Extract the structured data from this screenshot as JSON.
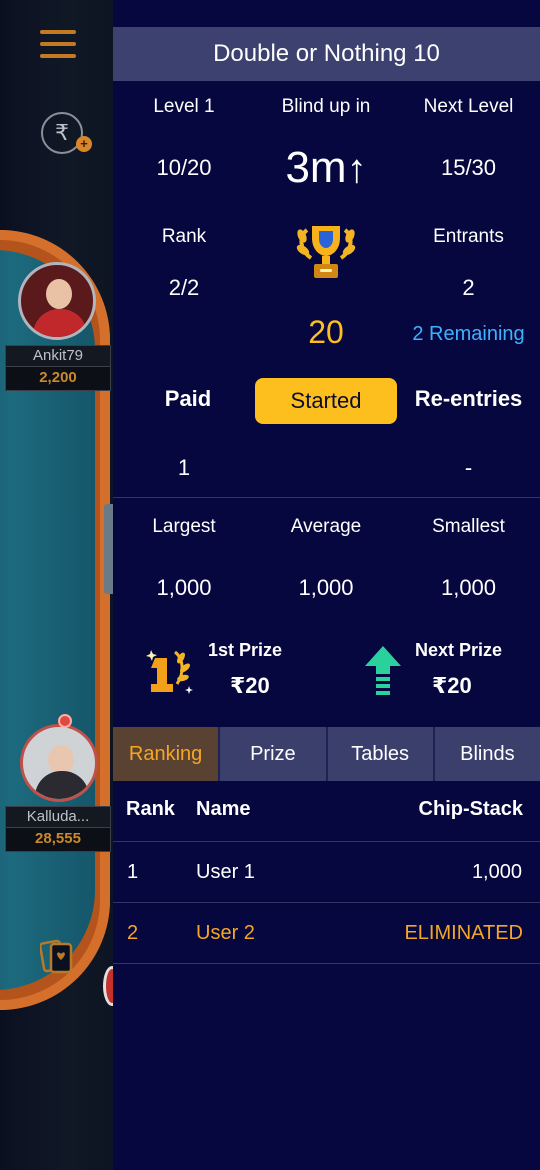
{
  "background": {
    "players": [
      {
        "name": "Ankit79",
        "chips": "2,200"
      },
      {
        "name": "Kalluda...",
        "chips": "28,555"
      }
    ],
    "rupee_symbol": "₹",
    "rupee_plus": "+"
  },
  "tournament": {
    "title": "Double or Nothing 10",
    "level_label": "Level 1",
    "level_value": "10/20",
    "blind_label": "Blind up in",
    "blind_value": "3m",
    "blind_arrow": "↑",
    "next_level_label": "Next Level",
    "next_level_value": "15/30",
    "rank_label": "Rank",
    "rank_value": "2/2",
    "entrants_label": "Entrants",
    "entrants_value": "2",
    "prize_pool": "20",
    "remaining": "2 Remaining",
    "paid_label": "Paid",
    "paid_value": "1",
    "status_button": "Started",
    "reentries_label": "Re-entries",
    "reentries_value": "-",
    "stacks": {
      "largest_label": "Largest",
      "largest_value": "1,000",
      "average_label": "Average",
      "average_value": "1,000",
      "smallest_label": "Smallest",
      "smallest_value": "1,000"
    },
    "first_prize_label": "1st Prize",
    "first_prize_value": "₹20",
    "next_prize_label": "Next Prize",
    "next_prize_value": "₹20"
  },
  "tabs": [
    "Ranking",
    "Prize",
    "Tables",
    "Blinds"
  ],
  "ranking": {
    "headers": {
      "rank": "Rank",
      "name": "Name",
      "chips": "Chip-Stack"
    },
    "rows": [
      {
        "rank": "1",
        "name": "User 1",
        "chips": "1,000"
      },
      {
        "rank": "2",
        "name": "User 2",
        "chips": "ELIMINATED"
      }
    ]
  },
  "colors": {
    "accent": "#fdbf1e",
    "highlight_row": "#f5a623",
    "remaining_text": "#3fb2ff",
    "panel_bg": "#05073e"
  }
}
